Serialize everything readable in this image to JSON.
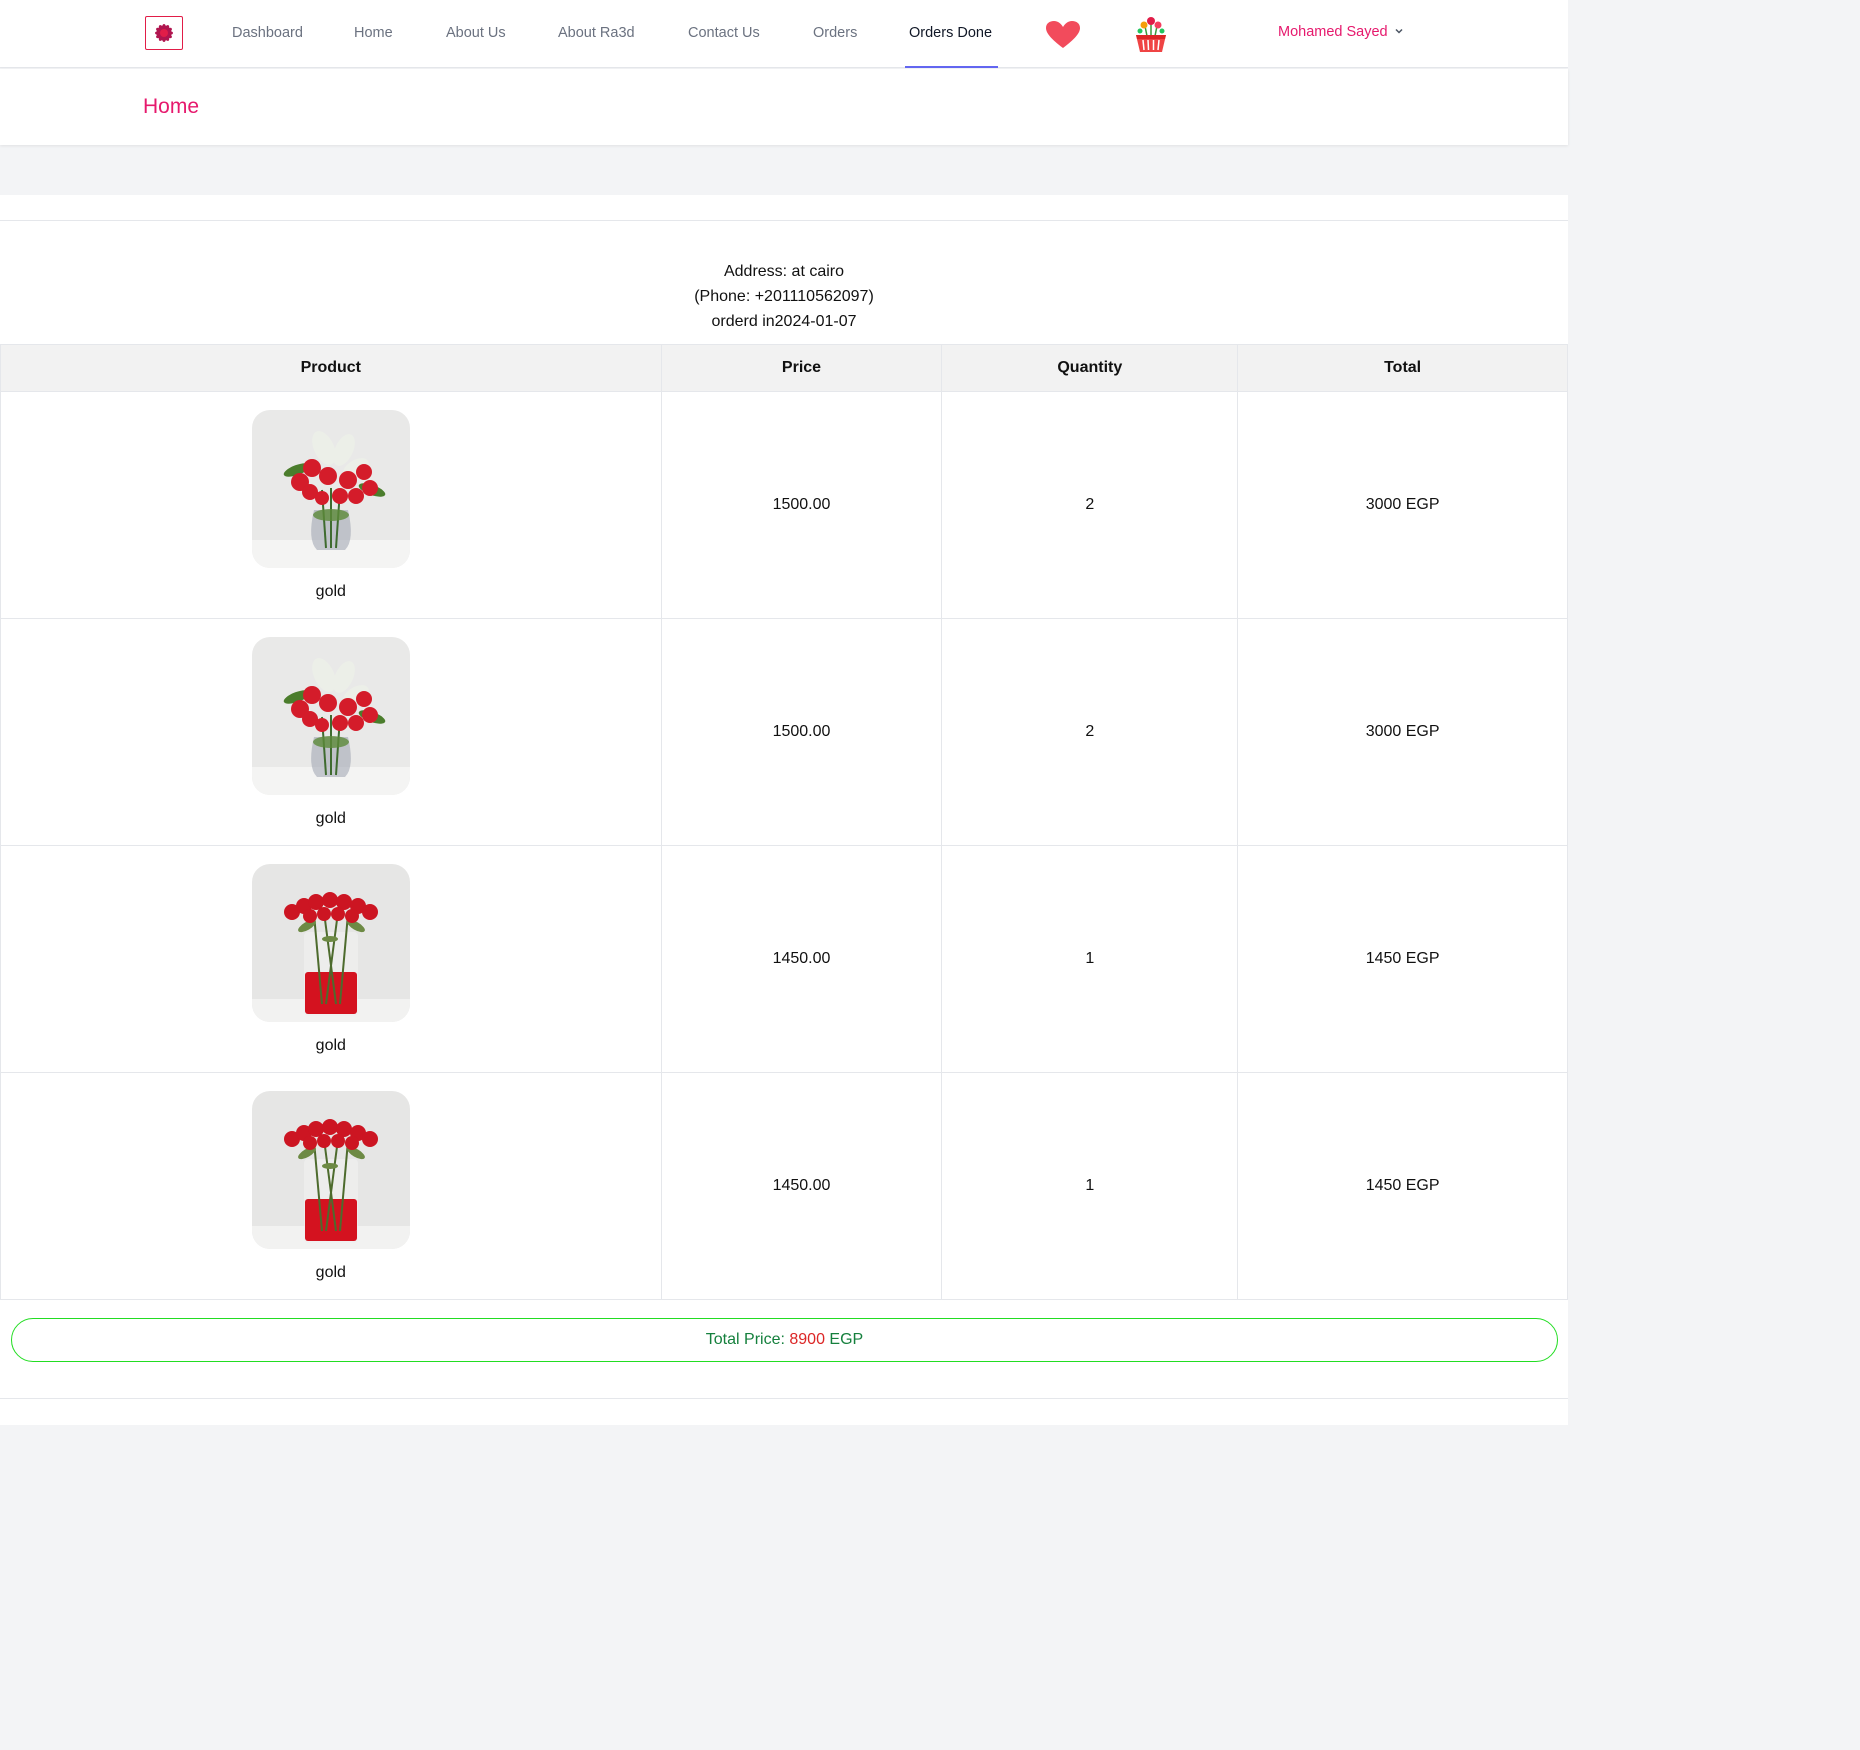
{
  "nav": {
    "links": [
      "Dashboard",
      "Home",
      "About Us",
      "About Ra3d",
      "Contact Us",
      "Orders",
      "Orders Done"
    ],
    "active": "Orders Done",
    "user_name": "Mohamed Sayed"
  },
  "header": {
    "title": "Home"
  },
  "order": {
    "address": "Address: at cairo",
    "phone": "(Phone: +201110562097)",
    "date": "orderd in2024-01-07"
  },
  "table": {
    "headers": [
      "Product",
      "Price",
      "Quantity",
      "Total"
    ],
    "rows": [
      {
        "name": "gold",
        "price": "1500.00",
        "quantity": "2",
        "total": "3000 EGP",
        "image": "mixed-bouquet"
      },
      {
        "name": "gold",
        "price": "1500.00",
        "quantity": "2",
        "total": "3000 EGP",
        "image": "mixed-bouquet"
      },
      {
        "name": "gold",
        "price": "1450.00",
        "quantity": "1",
        "total": "1450 EGP",
        "image": "red-roses-vase"
      },
      {
        "name": "gold",
        "price": "1450.00",
        "quantity": "1",
        "total": "1450 EGP",
        "image": "red-roses-vase"
      }
    ]
  },
  "summary": {
    "label": "Total Price: ",
    "amount": "8900",
    "currency": " EGP"
  },
  "colors": {
    "brand": "#e6196d",
    "accent": "#6366f1",
    "total_green": "#15803d",
    "total_red": "#dc2626"
  }
}
